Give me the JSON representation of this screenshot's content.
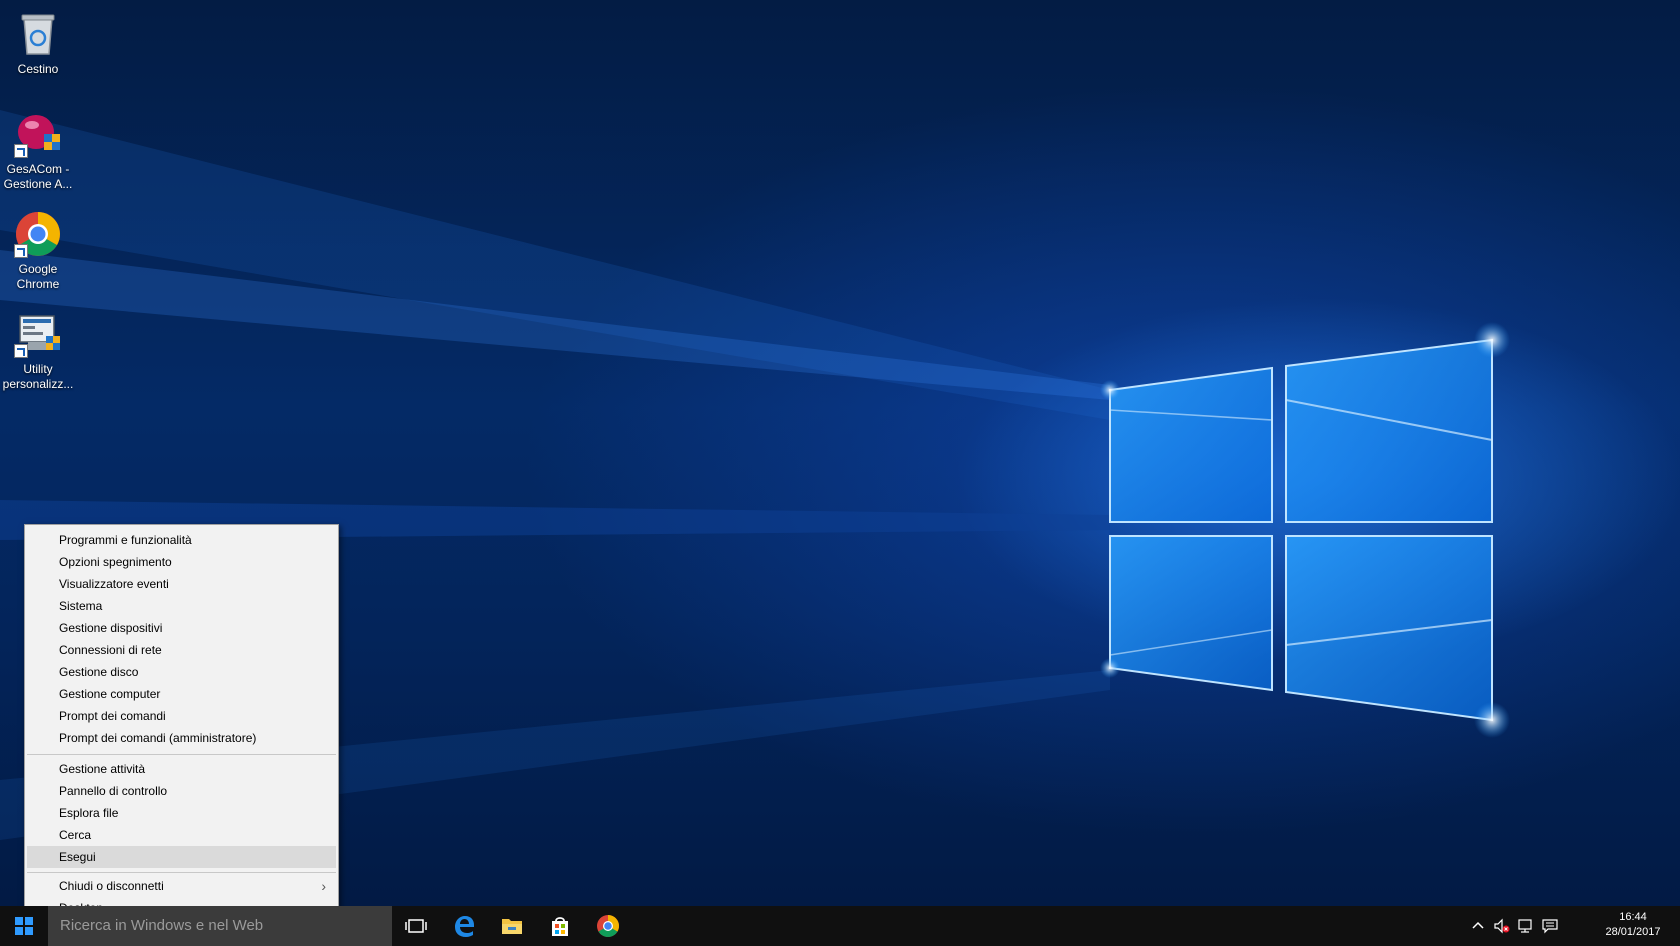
{
  "desktop": {
    "icons": [
      {
        "label": "Cestino",
        "icon": "recycle-bin-icon"
      },
      {
        "label": "GesACom - Gestione A...",
        "icon": "gesacom-icon"
      },
      {
        "label": "Google Chrome",
        "icon": "chrome-icon"
      },
      {
        "label": "Utility personalizz...",
        "icon": "utility-icon"
      }
    ]
  },
  "context_menu": {
    "group1": [
      "Programmi e funzionalità",
      "Opzioni spegnimento",
      "Visualizzatore eventi",
      "Sistema",
      "Gestione dispositivi",
      "Connessioni di rete",
      "Gestione disco",
      "Gestione computer",
      "Prompt dei comandi",
      "Prompt dei comandi (amministratore)"
    ],
    "group2": [
      "Gestione attività",
      "Pannello di controllo",
      "Esplora file",
      "Cerca",
      "Esegui"
    ],
    "highlighted": "Esegui",
    "group3": [
      "Chiudi o disconnetti",
      "Desktop"
    ]
  },
  "taskbar": {
    "search_placeholder": "Ricerca in Windows e nel Web",
    "apps": [
      "task-view-icon",
      "edge-icon",
      "file-explorer-icon",
      "store-icon",
      "chrome-icon"
    ],
    "clock_time": "16:44",
    "clock_date": "28/01/2017"
  },
  "colors": {
    "accent": "#2f9bff",
    "taskbar": "#101010",
    "menu_bg": "#f2f2f2",
    "menu_highlight": "#dadada"
  }
}
